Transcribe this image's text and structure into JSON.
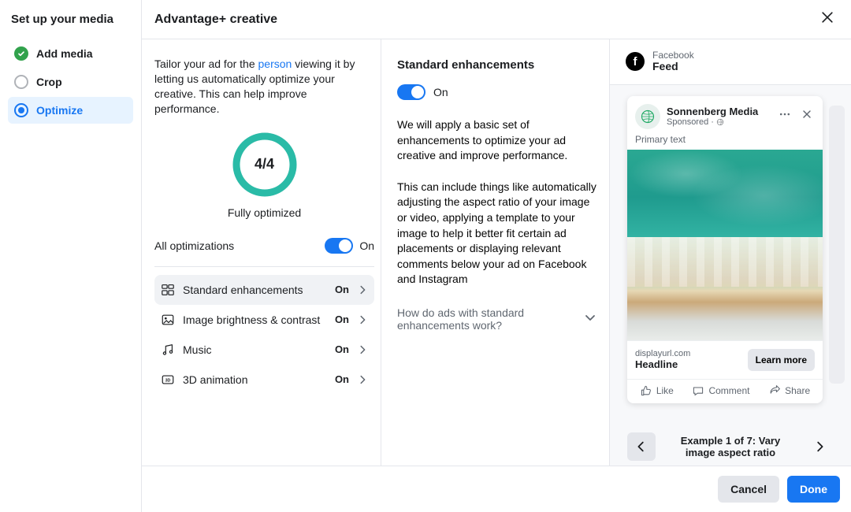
{
  "sidebar": {
    "title": "Set up your media",
    "steps": [
      {
        "label": "Add media",
        "state": "done"
      },
      {
        "label": "Crop",
        "state": "pending"
      },
      {
        "label": "Optimize",
        "state": "active"
      }
    ]
  },
  "header": {
    "title": "Advantage+ creative"
  },
  "col1": {
    "tailor_pre": "Tailor your ad for the ",
    "tailor_person": "person",
    "tailor_post": " viewing it by letting us automatically optimize your creative. This can help improve performance.",
    "ring_label": "4/4",
    "fully_optimized": "Fully optimized",
    "all_opt_label": "All optimizations",
    "all_opt_state": "On",
    "items": [
      {
        "label": "Standard enhancements",
        "state": "On",
        "icon": "grid"
      },
      {
        "label": "Image brightness & contrast",
        "state": "On",
        "icon": "image"
      },
      {
        "label": "Music",
        "state": "On",
        "icon": "music"
      },
      {
        "label": "3D animation",
        "state": "On",
        "icon": "3d"
      }
    ]
  },
  "col2": {
    "title": "Standard enhancements",
    "state": "On",
    "p1": "We will apply a basic set of enhancements to optimize your ad creative and improve performance.",
    "p2": "This can include things like automatically adjusting the aspect ratio of your image or video, applying a template to your image to help it better fit certain ad placements or displaying relevant comments below your ad on Facebook and Instagram",
    "accordion": "How do ads with standard enhancements work?"
  },
  "col3": {
    "placement_label": "Facebook",
    "placement_value": "Feed",
    "advertiser": "Sonnenberg Media",
    "sponsored": "Sponsored",
    "primary_text": "Primary text",
    "display_url": "displayurl.com",
    "headline": "Headline",
    "cta": "Learn more",
    "like": "Like",
    "comment": "Comment",
    "share": "Share",
    "example_label": "Example 1 of 7: Vary image aspect ratio"
  },
  "footer": {
    "cancel": "Cancel",
    "done": "Done"
  }
}
